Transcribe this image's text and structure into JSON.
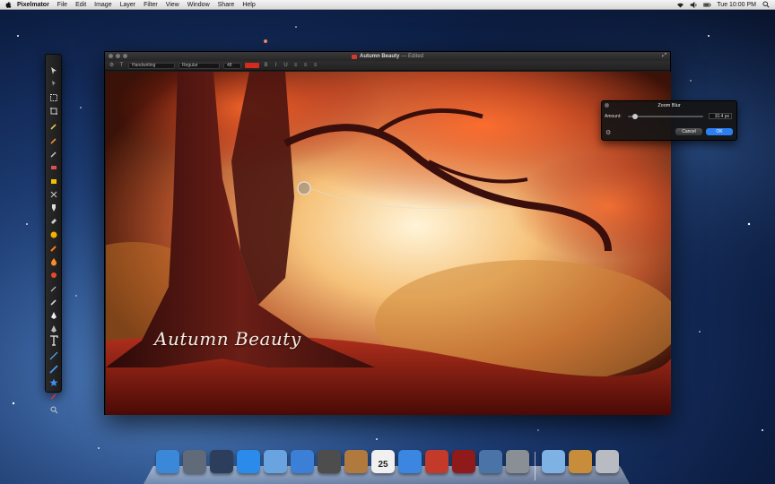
{
  "menubar": {
    "app_name": "Pixelmator",
    "items": [
      "File",
      "Edit",
      "Image",
      "Layer",
      "Filter",
      "View",
      "Window",
      "Share",
      "Help"
    ],
    "clock": "Tue 10:00 PM"
  },
  "window": {
    "title": "Autumn Beauty",
    "status": "— Edited"
  },
  "options_bar": {
    "font_family": "Handwriting",
    "font_style": "Regular",
    "font_size": "48",
    "color_swatch": "#d42a20"
  },
  "canvas": {
    "overlay_text": "Autumn Beauty"
  },
  "zoom_blur": {
    "title": "Zoom Blur",
    "amount_label": "Amount:",
    "amount_value": "10.4 px",
    "amount_fraction": 0.06,
    "cancel_label": "Cancel",
    "ok_label": "OK",
    "ok_color": "#2b7ff0"
  },
  "dock": {
    "apps": [
      {
        "name": "finder-icon",
        "color": "#3b88d8"
      },
      {
        "name": "launchpad-icon",
        "color": "#606a78"
      },
      {
        "name": "mission-control-icon",
        "color": "#2c3e5b"
      },
      {
        "name": "app-store-icon",
        "color": "#2a8bea"
      },
      {
        "name": "mail-icon",
        "color": "#6aa4e0"
      },
      {
        "name": "safari-icon",
        "color": "#3c7fd6"
      },
      {
        "name": "facetime-icon",
        "color": "#4d4d4d"
      },
      {
        "name": "address-book-icon",
        "color": "#b07a3e"
      },
      {
        "name": "ical-icon",
        "color": "#f0f0f0"
      },
      {
        "name": "itunes-icon",
        "color": "#3a86e0"
      },
      {
        "name": "pixelmator-icon",
        "color": "#c33a2a"
      },
      {
        "name": "photo-booth-icon",
        "color": "#8e1a1a"
      },
      {
        "name": "iphoto-icon",
        "color": "#4a74a8"
      },
      {
        "name": "system-preferences-icon",
        "color": "#8a8f96"
      }
    ],
    "calendar_day": "25",
    "right_items": [
      {
        "name": "applications-folder-icon",
        "color": "#7fb2e4"
      },
      {
        "name": "documents-stack-icon",
        "color": "#c78d3b"
      },
      {
        "name": "trash-icon",
        "color": "#b8bcc2"
      }
    ]
  }
}
